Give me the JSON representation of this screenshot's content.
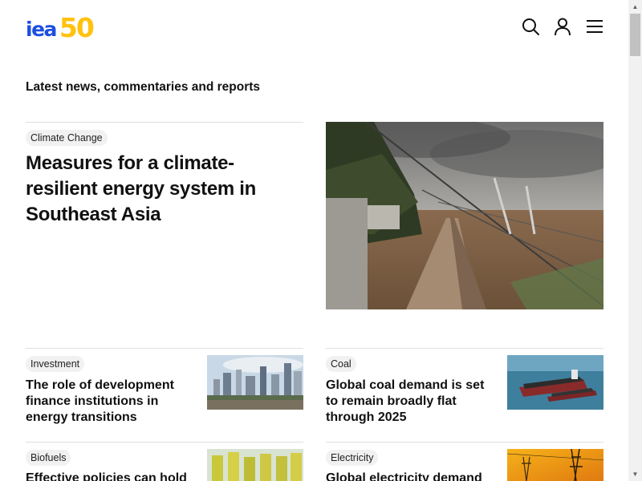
{
  "header": {
    "logo": {
      "brand": "iea",
      "anniversary": "50"
    },
    "icons": {
      "search": "search-icon",
      "account": "user-icon",
      "menu": "menu-icon"
    }
  },
  "section": {
    "title": "Latest news, commentaries and reports"
  },
  "featured": {
    "tag": "Climate Change",
    "title": "Measures for a climate-resilient energy system in Southeast Asia",
    "image": "storm-damaged-power-lines-photo"
  },
  "cards": [
    {
      "tag": "Investment",
      "title": "The role of development finance institutions in energy transitions",
      "image": "city-skyline-photo"
    },
    {
      "tag": "Coal",
      "title": "Global coal demand is set to remain broadly flat through 2025",
      "image": "coal-ships-photo"
    },
    {
      "tag": "Biofuels",
      "title": "Effective policies can hold",
      "image": "biofuel-bottles-photo"
    },
    {
      "tag": "Electricity",
      "title": "Global electricity demand",
      "image": "power-pylons-photo"
    }
  ],
  "colors": {
    "brand_blue": "#1c4fe0",
    "brand_yellow": "#ffc20e",
    "tag_bg": "#f1f1f1"
  }
}
